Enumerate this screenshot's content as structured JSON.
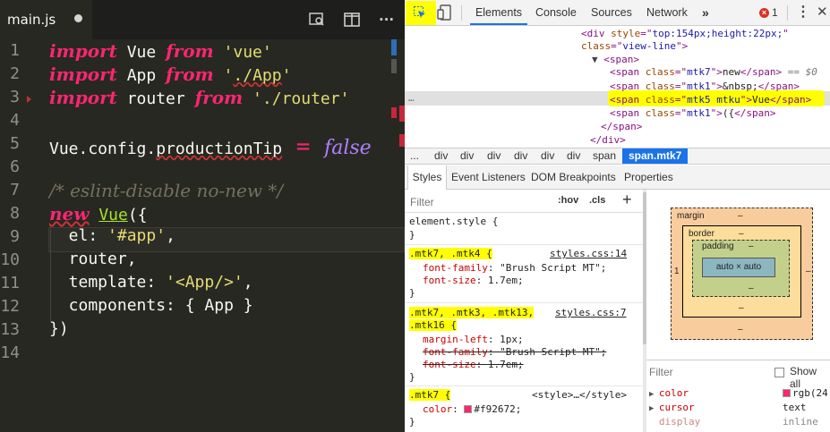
{
  "editor": {
    "tab_title": "main.js",
    "line_numbers": [
      "1",
      "2",
      "3",
      "4",
      "5",
      "6",
      "7",
      "8",
      "9",
      "10",
      "11",
      "12",
      "13",
      "14"
    ],
    "lines": {
      "l1_kw": "import",
      "l1_name": " Vue ",
      "l1_from": "from",
      "l1_str": " 'vue'",
      "l2_kw": "import",
      "l2_name": " App ",
      "l2_from": "from",
      "l2_str_q": " '",
      "l2_str_path": "./App",
      "l2_str_end": "'",
      "l3_kw": "import",
      "l3_name": " router ",
      "l3_from": "from",
      "l3_str": " './router'",
      "l5_obj": "Vue.config.",
      "l5_prop": "productionTip",
      "l5_op": " = ",
      "l5_bool": "false",
      "l7_comment": "/* eslint-disable no-new */",
      "l8_new": "new",
      "l8_sp": " ",
      "l8_cls": "Vue",
      "l8_rest": "({",
      "l9_key": "  el: ",
      "l9_str": "'#app'",
      "l9_end": ",",
      "l10": "  router,",
      "l11_key": "  template: ",
      "l11_str": "'<App/>'",
      "l11_end": ",",
      "l12": "  components: { App }",
      "l13": "})"
    },
    "colors": {
      "background": "#272822",
      "keyword": "#f92672",
      "string": "#e6db74",
      "comment": "#75715e",
      "boolean": "#ae81ff",
      "function": "#a6e22e"
    }
  },
  "devtools": {
    "tabs": [
      "Elements",
      "Console",
      "Sources",
      "Network"
    ],
    "more_tabs": "»",
    "error_count": "1",
    "dom": {
      "l1_open": "<div ",
      "l1_attr": "style",
      "l1_eq": "=\"",
      "l1_val": "top:154px;height:22px;",
      "l1_close": "\"",
      "l2_attr": "class",
      "l2_eq": "=\"",
      "l2_val": "view-line",
      "l2_close": "\">",
      "l3": "<span>",
      "l4_open": "<span ",
      "l4_attr": "class",
      "l4_eq": "=\"",
      "l4_val": "mtk7",
      "l4_q": "\">",
      "l4_text": "new",
      "l4_close": "</span>",
      "l4_ref": " == $0",
      "l5_open": "<span ",
      "l5_attr": "class",
      "l5_eq": "=\"",
      "l5_val": "mtk1",
      "l5_q": "\">",
      "l5_text": "&nbsp;",
      "l5_close": "</span>",
      "l6_open": "<span ",
      "l6_attr": "class",
      "l6_eq": "=\"",
      "l6_val": "mtk5 mtku",
      "l6_q": "\">",
      "l6_text": "Vue",
      "l6_close": "</span>",
      "l7_open": "<span ",
      "l7_attr": "class",
      "l7_eq": "=\"",
      "l7_val": "mtk1",
      "l7_q": "\">",
      "l7_text": "({",
      "l7_close": "</span>",
      "l8": "</span>",
      "l9": "</div>"
    },
    "breadcrumbs": [
      "...",
      "div",
      "div",
      "div",
      "div",
      "div",
      "div",
      "span",
      "span.mtk7"
    ],
    "style_tabs": [
      "Styles",
      "Event Listeners",
      "DOM Breakpoints",
      "Properties"
    ],
    "styles": {
      "filter_placeholder": "Filter",
      "hov": ":hov",
      "cls": ".cls",
      "add": "+",
      "element_style": "element.style {",
      "close_brace": "}",
      "r1_sel": ".mtk7, .mtk4 {",
      "r1_src": "styles.css:14",
      "r1_p1_name": "font-family",
      "r1_p1_val": "\"Brush Script MT\";",
      "r1_p2_name": "font-size",
      "r1_p2_val": "1.7em;",
      "r2_sel_a": ".mtk7, .mtk3, .mtk13,",
      "r2_sel_b": ".mtk16 {",
      "r2_src": "styles.css:7",
      "r2_p1_name": "margin-left",
      "r2_p1_val": "1px;",
      "r2_p2_name": "font-family",
      "r2_p2_val": "\"Brush Script MT\";",
      "r2_p3_name": "font-size",
      "r2_p3_val": "1.7em;",
      "r3_sel": ".mtk7 {",
      "r3_src": "<style>…</style>",
      "r3_p1_name": "color",
      "r3_p1_val": "#f92672;"
    },
    "box_model": {
      "margin_label": "margin",
      "border_label": "border",
      "padding_label": "padding",
      "content": "auto × auto",
      "margin_value": "–",
      "border_value": "–",
      "padding_value": "–",
      "left_value": "1"
    },
    "computed": {
      "filter_placeholder": "Filter",
      "show_all": "Show all",
      "rows": [
        {
          "name": "color",
          "value": "rgb(24"
        },
        {
          "name": "cursor",
          "value": "text"
        },
        {
          "name": "display",
          "value": "inline"
        }
      ]
    }
  }
}
